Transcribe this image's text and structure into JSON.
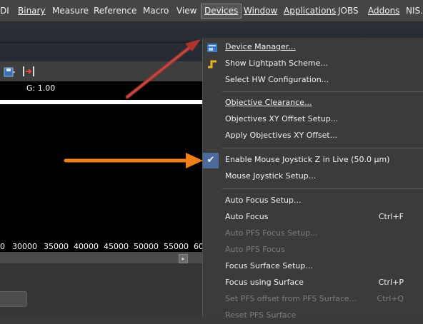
{
  "menubar": {
    "items": [
      {
        "label": "DI",
        "underline": ""
      },
      {
        "label": "Binary"
      },
      {
        "label": "Measure"
      },
      {
        "label": "Reference"
      },
      {
        "label": "Macro"
      },
      {
        "label": "View"
      },
      {
        "label": "Devices"
      },
      {
        "label": "Window"
      },
      {
        "label": "Applications"
      },
      {
        "label": "JOBS"
      },
      {
        "label": "Addons"
      },
      {
        "label": "NIS..."
      }
    ],
    "active": "Devices"
  },
  "image_panel": {
    "gain_text": "G: 1.00",
    "axis_ticks": [
      "0",
      "30000",
      "35000",
      "40000",
      "45000",
      "50000",
      "55000",
      "60"
    ]
  },
  "devices_menu": {
    "items": [
      {
        "label": "Device Manager...",
        "shortcut": "",
        "enabled": true,
        "icon": "device-manager-icon"
      },
      {
        "label": "Show Lightpath Scheme...",
        "shortcut": "",
        "enabled": true,
        "icon": "lightpath-icon"
      },
      {
        "label": "Select HW Configuration...",
        "shortcut": "",
        "enabled": true
      },
      {
        "label": "Objective Clearance...",
        "shortcut": "",
        "enabled": true
      },
      {
        "label": "Objectives XY Offset Setup...",
        "shortcut": "",
        "enabled": true
      },
      {
        "label": "Apply Objectives XY Offset...",
        "shortcut": "",
        "enabled": true
      },
      {
        "label": "Enable Mouse Joystick Z in Live (50.0 µm)",
        "shortcut": "",
        "enabled": true,
        "checked": true
      },
      {
        "label": "Mouse Joystick Setup...",
        "shortcut": "",
        "enabled": true
      },
      {
        "label": "Auto Focus Setup...",
        "shortcut": "",
        "enabled": true
      },
      {
        "label": "Auto Focus",
        "shortcut": "Ctrl+F",
        "enabled": true
      },
      {
        "label": "Auto PFS Focus Setup...",
        "shortcut": "",
        "enabled": false
      },
      {
        "label": "Auto PFS Focus",
        "shortcut": "",
        "enabled": false
      },
      {
        "label": "Focus Surface Setup...",
        "shortcut": "",
        "enabled": true
      },
      {
        "label": "Focus using Surface",
        "shortcut": "Ctrl+P",
        "enabled": true
      },
      {
        "label": "Set PFS offset from PFS Surface...",
        "shortcut": "Ctrl+Q",
        "enabled": false
      },
      {
        "label": "Reset PFS Surface",
        "shortcut": "",
        "enabled": false
      }
    ]
  },
  "colors": {
    "arrow_red": "#b0322a",
    "arrow_orange": "#f07f1a",
    "check_bg": "#4a6b9a"
  }
}
